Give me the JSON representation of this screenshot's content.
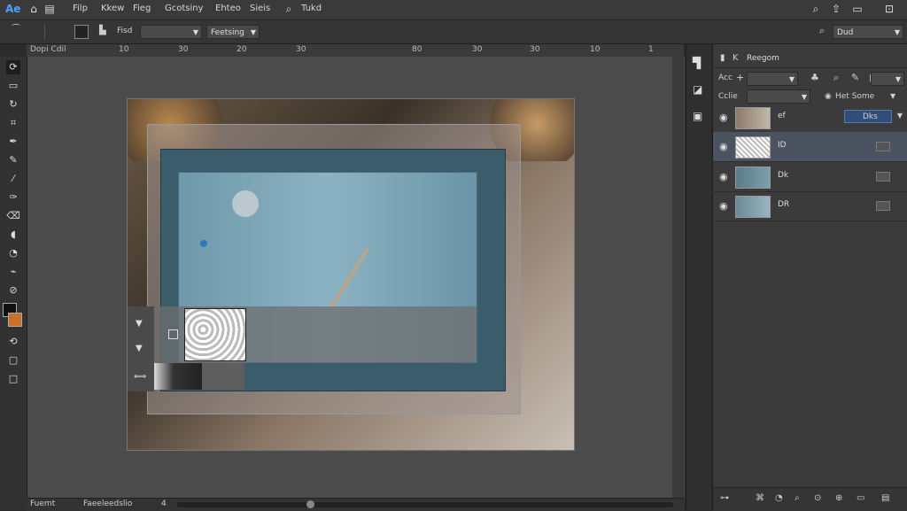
{
  "menubar": {
    "logo": "Ae",
    "items": [
      "Filp",
      "Kkew",
      "Fieg",
      "Gcotsiny",
      "Ehteo",
      "Sieis"
    ],
    "search_label": "Tukd",
    "icons": [
      "home-icon",
      "search-icon",
      "export-icon",
      "window-icon",
      "close-icon"
    ]
  },
  "options": {
    "label1": "Fisd",
    "dropdown1": "",
    "dropdown2": "Feetsing",
    "right_label": "Dud"
  },
  "ruler": {
    "ticks": [
      "Dopi Cdil",
      "10",
      "30",
      "20",
      "30",
      "80",
      "30",
      "30",
      "10",
      "1"
    ]
  },
  "tools": [
    "lasso-icon",
    "marquee-icon",
    "quick-select-icon",
    "crop-icon",
    "eyedropper-icon",
    "healing-icon",
    "brush-icon",
    "clone-icon",
    "eraser-icon",
    "gradient-icon",
    "dodge-icon",
    "pen-icon",
    "type-icon",
    "shape-icon",
    "hand-icon",
    "zoom-icon"
  ],
  "panel": {
    "title": "Reegom",
    "row1_label": "Acc",
    "row2_label": "Cclie",
    "blend_label": "Het Some",
    "layers": [
      {
        "name": "ef",
        "badge": "Dks",
        "selected": false
      },
      {
        "name": "ID",
        "selected": true
      },
      {
        "name": "Dk",
        "selected": false
      },
      {
        "name": "DR",
        "selected": false
      }
    ]
  },
  "status": {
    "left": "Fuemt",
    "mid": "Faeeleedslio",
    "num": "4"
  }
}
